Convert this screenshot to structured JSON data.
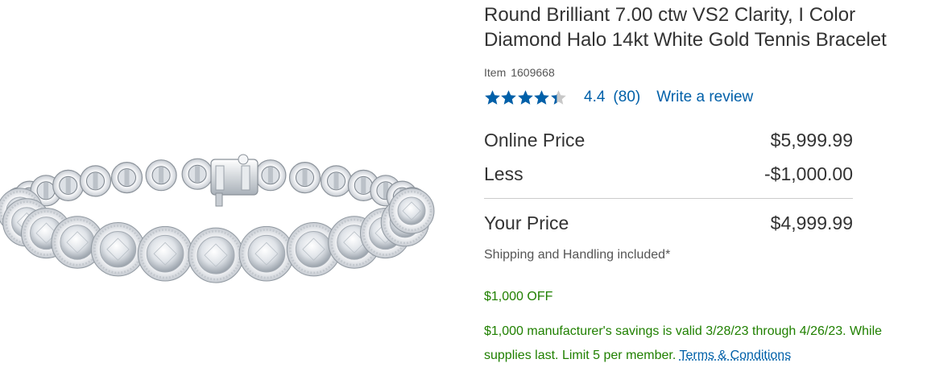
{
  "product": {
    "title": "Round Brilliant 7.00 ctw VS2 Clarity, I Color Diamond Halo 14kt White Gold Tennis Bracelet",
    "item_label": "Item",
    "item_number": "1609668",
    "image_icon": "diamond-tennis-bracelet"
  },
  "rating": {
    "value": "4.4",
    "stars_value": 4.4,
    "stars_max": 5,
    "count": "(80)",
    "write_review": "Write a review",
    "star_color": "#0060a9"
  },
  "pricing": {
    "online_label": "Online Price",
    "online_value": "$5,999.99",
    "less_label": "Less",
    "less_value": "-$1,000.00",
    "your_label": "Your Price",
    "your_value": "$4,999.99",
    "shipping": "Shipping and Handling included*"
  },
  "promo": {
    "off_text": "$1,000 OFF",
    "detail_text": "$1,000 manufacturer's savings is valid 3/28/23 through 4/26/23. While supplies last. Limit 5 per member.",
    "terms_link": "Terms & Conditions",
    "color": "#208000"
  }
}
